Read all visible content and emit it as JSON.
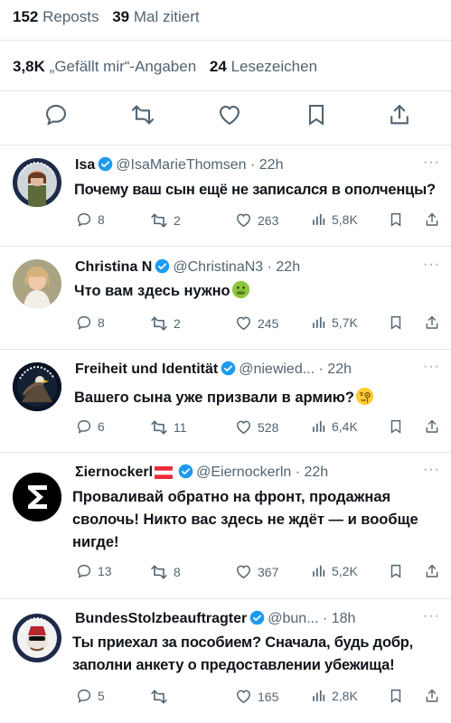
{
  "stats": {
    "reposts_count": "152",
    "reposts_label": "Reposts",
    "quotes_count": "39",
    "quotes_label": "Mal zitiert",
    "likes_count": "3,8K",
    "likes_label": "„Gefällt mir“-Angaben",
    "bookmarks_count": "24",
    "bookmarks_label": "Lesezeichen"
  },
  "main_actions": [
    "reply-icon",
    "repost-icon",
    "like-icon",
    "bookmark-icon",
    "share-icon"
  ],
  "colors": {
    "text": "#0f1419",
    "secondary": "#536471",
    "verified": "#1d9bf0",
    "divider": "#e1e6ea"
  },
  "replies": [
    {
      "name": "Isa",
      "handle": "@IsaMarieThomsen",
      "time": "· 22h",
      "text": "Почему ваш сын ещё не записался в ополченцы?",
      "replies": "8",
      "reposts": "2",
      "likes": "263",
      "views": "5,8K"
    },
    {
      "name": "Christina N",
      "handle": "@ChristinaN3",
      "time": "· 22h",
      "text": "Что вам здесь нужно",
      "emoji": "nauseated-face",
      "replies": "8",
      "reposts": "2",
      "likes": "245",
      "views": "5,7K"
    },
    {
      "name": "Freiheit und Identität",
      "handle": "@niewied...",
      "time": "· 22h",
      "text": "Вашего сына уже призвали в армию?",
      "emoji": "face-with-monocle",
      "replies": "6",
      "reposts": "11",
      "likes": "528",
      "views": "6,4K"
    },
    {
      "name": "Ʃiernockerl",
      "flag": "austria",
      "handle": "@Eiernockerln",
      "time": "· 22h",
      "text": "Проваливай обратно на фронт, продажная сволочь! Никто вас здесь не ждёт — и вообще нигде!",
      "replies": "13",
      "reposts": "8",
      "likes": "367",
      "views": "5,2K"
    },
    {
      "name": "BundesStolzbeauftragter",
      "handle": "@bun...",
      "time": "· 18h",
      "text": "Ты приехал за пособием? Сначала, будь добр, заполни анкету о предоставлении убежища!",
      "replies": "5",
      "reposts": "",
      "likes": "165",
      "views": "2,8K"
    }
  ]
}
